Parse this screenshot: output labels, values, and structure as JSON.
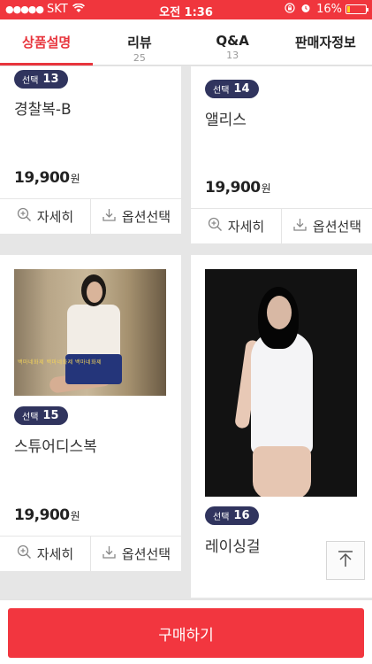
{
  "status_bar": {
    "signal": "●●●●●",
    "carrier": "SKT",
    "time": "오전 1:36",
    "battery": "16%",
    "battery_level": 0.16
  },
  "tabs": [
    {
      "label": "상품설명",
      "count": "",
      "active": true
    },
    {
      "label": "리뷰",
      "count": "25"
    },
    {
      "label": "Q&A",
      "count": "13"
    },
    {
      "label": "판매자정보",
      "count": ""
    }
  ],
  "products": [
    {
      "badge_prefix": "선택",
      "badge_number": "13",
      "name": "경찰복-B",
      "price": "19,900",
      "price_unit": "원"
    },
    {
      "badge_prefix": "선택",
      "badge_number": "14",
      "name": "앨리스",
      "price": "19,900",
      "price_unit": "원"
    },
    {
      "badge_prefix": "선택",
      "badge_number": "15",
      "name": "스튜어디스복",
      "price": "19,900",
      "price_unit": "원"
    },
    {
      "badge_prefix": "선택",
      "badge_number": "16",
      "name": "레이싱걸"
    }
  ],
  "actions": {
    "detail": "자세히",
    "option": "옵션선택"
  },
  "watermark": "백마네화제 백마네화제 백마네화제",
  "buy_button": "구매하기",
  "colors": {
    "accent": "#f2363f",
    "badge": "#30345e",
    "background": "#e6e6e6"
  }
}
